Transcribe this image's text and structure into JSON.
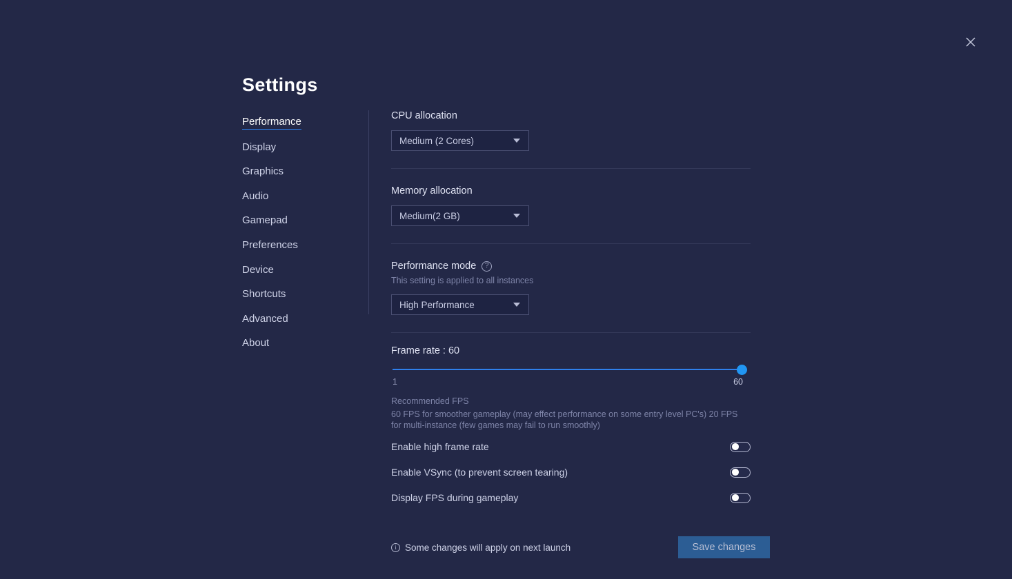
{
  "window": {
    "title": "Settings",
    "close_icon": "close-icon"
  },
  "sidebar": {
    "items": [
      {
        "label": "Performance",
        "active": true
      },
      {
        "label": "Display",
        "active": false
      },
      {
        "label": "Graphics",
        "active": false
      },
      {
        "label": "Audio",
        "active": false
      },
      {
        "label": "Gamepad",
        "active": false
      },
      {
        "label": "Preferences",
        "active": false
      },
      {
        "label": "Device",
        "active": false
      },
      {
        "label": "Shortcuts",
        "active": false
      },
      {
        "label": "Advanced",
        "active": false
      },
      {
        "label": "About",
        "active": false
      }
    ]
  },
  "main": {
    "cpu": {
      "label": "CPU allocation",
      "value": "Medium (2 Cores)"
    },
    "memory": {
      "label": "Memory allocation",
      "value": "Medium(2 GB)"
    },
    "performance_mode": {
      "label": "Performance mode",
      "help_icon": "help-circle-icon",
      "subtitle": "This setting is applied to all instances",
      "value": "High Performance"
    },
    "frame_rate": {
      "label": "Frame rate : 60",
      "value": 60,
      "min": 1,
      "max": 60,
      "min_label": "1",
      "max_label": "60",
      "fill_percent": 100,
      "track_color": "#2f80ed",
      "thumb_color": "#2196f3"
    },
    "recommended": {
      "title": "Recommended FPS",
      "body": "60 FPS for smoother gameplay (may effect performance on some entry level PC's) 20 FPS for multi-instance (few games may fail to run smoothly)"
    },
    "toggles": [
      {
        "label": "Enable high frame rate",
        "on": false
      },
      {
        "label": "Enable VSync (to prevent screen tearing)",
        "on": false
      },
      {
        "label": "Display FPS during gameplay",
        "on": false
      }
    ]
  },
  "footer": {
    "info_icon": "info-circle-icon",
    "note": "Some changes will apply on next launch",
    "save_label": "Save changes",
    "save_color": "#2c5d94"
  }
}
